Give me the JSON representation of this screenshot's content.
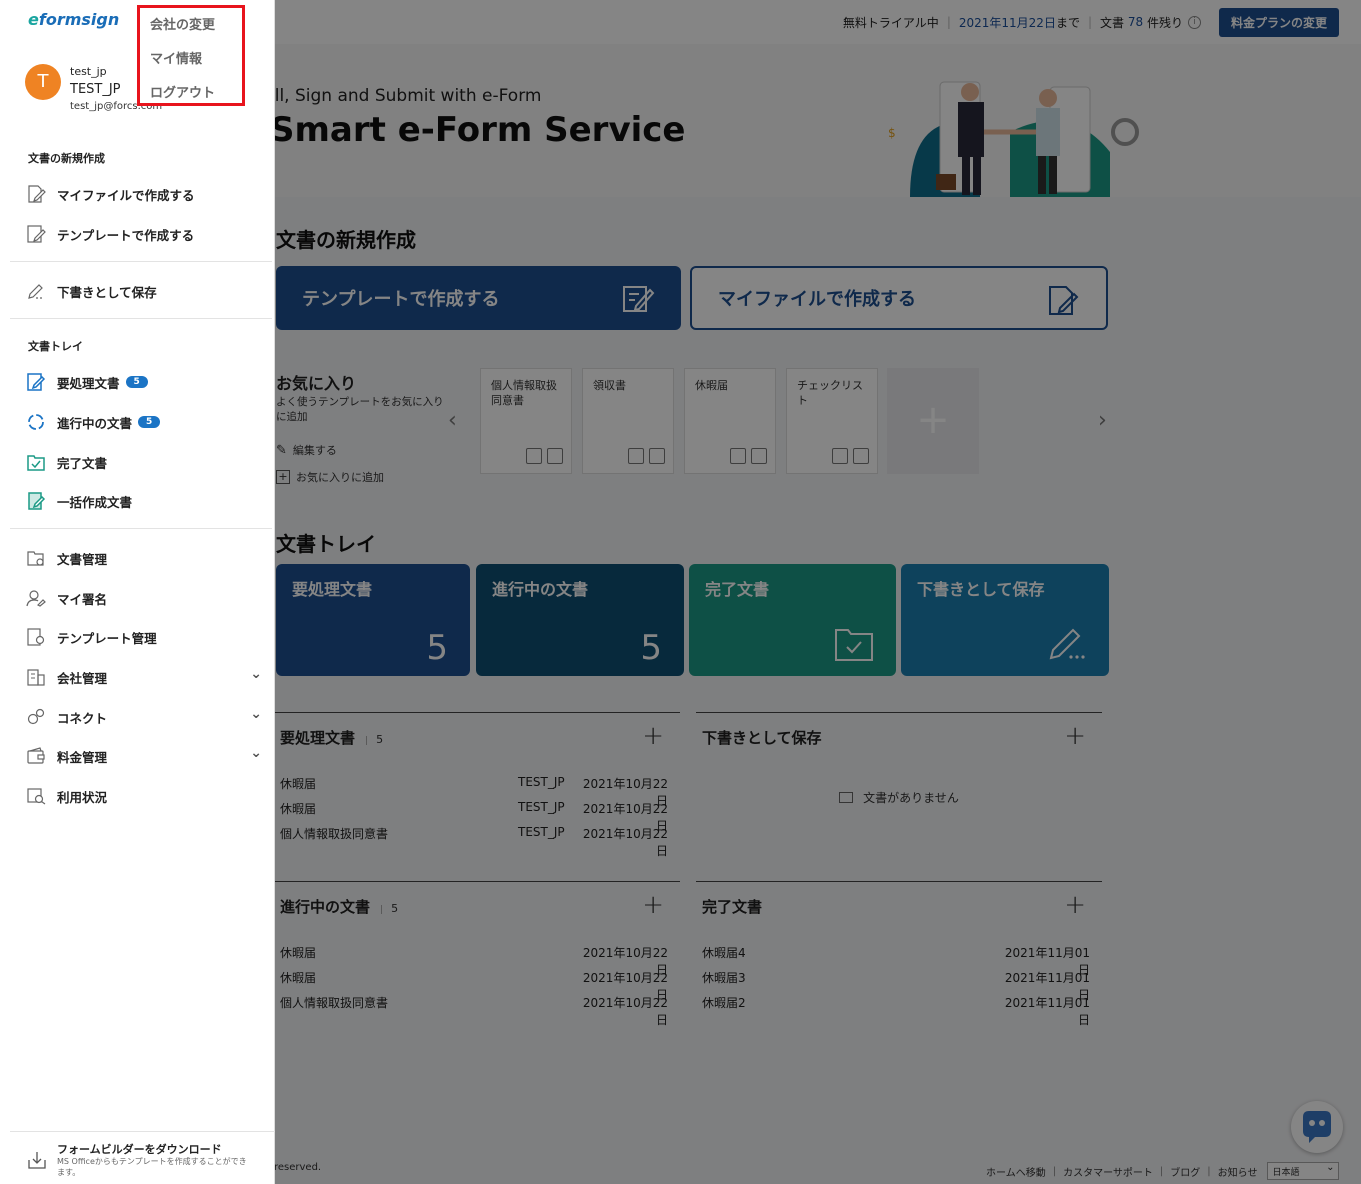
{
  "topbar": {
    "trial": "無料トライアル中",
    "date": "2021年11月22日",
    "date_suffix": "まで",
    "docs_prefix": "文書",
    "docs_count": "78",
    "docs_suffix": "件残り",
    "plan_button": "料金プランの変更"
  },
  "hero": {
    "subtitle": "ill, Sign and Submit with e-Form",
    "title": "Smart e-Form Service"
  },
  "new_doc": {
    "title": "文書の新規作成",
    "template_card": "テンプレートで作成する",
    "myfile_card": "マイファイルで作成する"
  },
  "favorites": {
    "title": "お気に入り",
    "desc": "よく使うテンプレートをお気に入りに追加",
    "edit_link": "編集する",
    "add_link": "お気に入りに追加",
    "cards": [
      "個人情報取扱同意書",
      "領収書",
      "休暇届",
      "チェックリスト"
    ]
  },
  "tray": {
    "title": "文書トレイ",
    "cards": [
      {
        "label": "要処理文書",
        "count": "5"
      },
      {
        "label": "進行中の文書",
        "count": "5"
      },
      {
        "label": "完了文書"
      },
      {
        "label": "下書きとして保存"
      }
    ]
  },
  "panels": {
    "pending": {
      "title": "要処理文書",
      "count": "5",
      "rows": [
        {
          "name": "休暇届",
          "user": "TEST_JP",
          "date": "2021年10月22日"
        },
        {
          "name": "休暇届",
          "user": "TEST_JP",
          "date": "2021年10月22日"
        },
        {
          "name": "個人情報取扱同意書",
          "user": "TEST_JP",
          "date": "2021年10月22日"
        }
      ]
    },
    "drafts": {
      "title": "下書きとして保存",
      "empty": "文書がありません"
    },
    "inprogress": {
      "title": "進行中の文書",
      "count": "5",
      "rows": [
        {
          "name": "休暇届",
          "date": "2021年10月22日"
        },
        {
          "name": "休暇届",
          "date": "2021年10月22日"
        },
        {
          "name": "個人情報取扱同意書",
          "date": "2021年10月22日"
        }
      ]
    },
    "completed": {
      "title": "完了文書",
      "rows": [
        {
          "name": "休暇届4",
          "date": "2021年11月01日"
        },
        {
          "name": "休暇届3",
          "date": "2021年11月01日"
        },
        {
          "name": "休暇届2",
          "date": "2021年11月01日"
        }
      ]
    }
  },
  "footer": {
    "copyright": "reserved.",
    "links": [
      "ホームへ移動",
      "カスタマーサポート",
      "ブログ",
      "お知らせ"
    ],
    "language": "日本語"
  },
  "sidebar": {
    "logo_e": "e",
    "logo_rest": "formsign",
    "avatar_letter": "T",
    "user_id": "test_jp",
    "user_name": "TEST_JP",
    "user_email": "test_jp@forcs.com",
    "section_new": "文書の新規作成",
    "create_myfile": "マイファイルで作成する",
    "create_template": "テンプレートで作成する",
    "save_draft": "下書きとして保存",
    "section_tray": "文書トレイ",
    "pending": "要処理文書",
    "pending_badge": "5",
    "inprogress": "進行中の文書",
    "inprogress_badge": "5",
    "completed": "完了文書",
    "bulk": "一括作成文書",
    "doc_manage": "文書管理",
    "my_signature": "マイ署名",
    "template_manage": "テンプレート管理",
    "company_manage": "会社管理",
    "connect": "コネクト",
    "billing": "料金管理",
    "usage": "利用状況",
    "download_title": "フォームビルダーをダウンロード",
    "download_desc": "MS Officeからもテンプレートを作成することができます。"
  },
  "dropdown": {
    "items": [
      "会社の変更",
      "マイ情報",
      "ログアウト"
    ]
  },
  "colors": {
    "tray_pending": "#1d4f91",
    "tray_inprogress": "#0f4f73",
    "tray_completed": "#1c9a86",
    "tray_draft": "#1b7fb0",
    "highlight": "#e8141d",
    "avatar": "#ef8323"
  }
}
